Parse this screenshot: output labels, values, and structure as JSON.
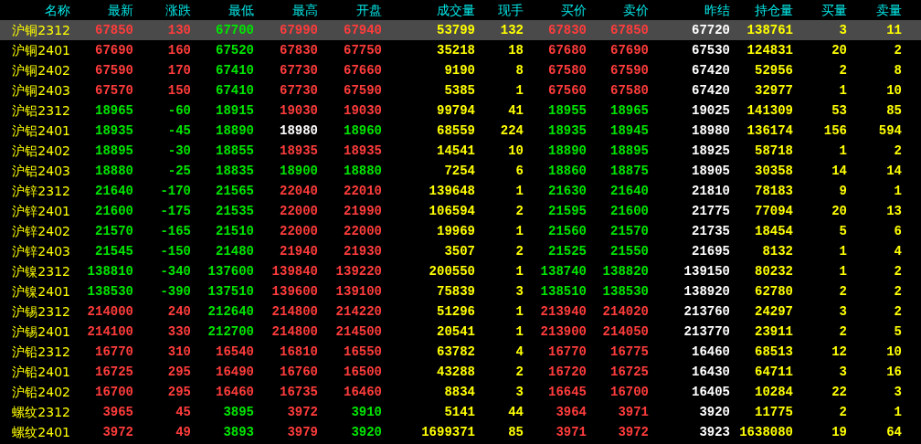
{
  "table": {
    "columns": [
      {
        "label": "名称",
        "kind": "name"
      },
      {
        "label": "最新",
        "kind": "price"
      },
      {
        "label": "涨跌",
        "kind": "price"
      },
      {
        "label": "最低",
        "kind": "price"
      },
      {
        "label": "最高",
        "kind": "price"
      },
      {
        "label": "开盘",
        "kind": "price"
      },
      {
        "label": "成交量",
        "kind": "volume"
      },
      {
        "label": "现手",
        "kind": "volume"
      },
      {
        "label": "买价",
        "kind": "price"
      },
      {
        "label": "卖价",
        "kind": "price"
      },
      {
        "label": "昨结",
        "kind": "settle"
      },
      {
        "label": "持仓量",
        "kind": "volume"
      },
      {
        "label": "买量",
        "kind": "volume"
      },
      {
        "label": "卖量",
        "kind": "volume"
      }
    ],
    "rows": [
      {
        "selected": true,
        "cells": [
          "沪铜2312",
          {
            "text": "67850",
            "color": "#ff3c3c"
          },
          {
            "text": "130",
            "color": "#ff3c3c"
          },
          {
            "text": "67700",
            "color": "#00e600"
          },
          {
            "text": "67990",
            "color": "#ff3c3c"
          },
          {
            "text": "67940",
            "color": "#ff3c3c"
          },
          "53799",
          "132",
          {
            "text": "67830",
            "color": "#ff3c3c"
          },
          {
            "text": "67850",
            "color": "#ff3c3c"
          },
          "67720",
          "138761",
          "3",
          "11"
        ]
      },
      {
        "selected": false,
        "cells": [
          "沪铜2401",
          {
            "text": "67690",
            "color": "#ff3c3c"
          },
          {
            "text": "160",
            "color": "#ff3c3c"
          },
          {
            "text": "67520",
            "color": "#00e600"
          },
          {
            "text": "67830",
            "color": "#ff3c3c"
          },
          {
            "text": "67750",
            "color": "#ff3c3c"
          },
          "35218",
          "18",
          {
            "text": "67680",
            "color": "#ff3c3c"
          },
          {
            "text": "67690",
            "color": "#ff3c3c"
          },
          "67530",
          "124831",
          "20",
          "2"
        ]
      },
      {
        "selected": false,
        "cells": [
          "沪铜2402",
          {
            "text": "67590",
            "color": "#ff3c3c"
          },
          {
            "text": "170",
            "color": "#ff3c3c"
          },
          {
            "text": "67410",
            "color": "#00e600"
          },
          {
            "text": "67730",
            "color": "#ff3c3c"
          },
          {
            "text": "67660",
            "color": "#ff3c3c"
          },
          "9190",
          "8",
          {
            "text": "67580",
            "color": "#ff3c3c"
          },
          {
            "text": "67590",
            "color": "#ff3c3c"
          },
          "67420",
          "52956",
          "2",
          "8"
        ]
      },
      {
        "selected": false,
        "cells": [
          "沪铜2403",
          {
            "text": "67570",
            "color": "#ff3c3c"
          },
          {
            "text": "150",
            "color": "#ff3c3c"
          },
          {
            "text": "67410",
            "color": "#00e600"
          },
          {
            "text": "67730",
            "color": "#ff3c3c"
          },
          {
            "text": "67590",
            "color": "#ff3c3c"
          },
          "5385",
          "1",
          {
            "text": "67560",
            "color": "#ff3c3c"
          },
          {
            "text": "67580",
            "color": "#ff3c3c"
          },
          "67420",
          "32977",
          "1",
          "10"
        ]
      },
      {
        "selected": false,
        "cells": [
          "沪铝2312",
          {
            "text": "18965",
            "color": "#00e600"
          },
          {
            "text": "-60",
            "color": "#00e600"
          },
          {
            "text": "18915",
            "color": "#00e600"
          },
          {
            "text": "19030",
            "color": "#ff3c3c"
          },
          {
            "text": "19030",
            "color": "#ff3c3c"
          },
          "99794",
          "41",
          {
            "text": "18955",
            "color": "#00e600"
          },
          {
            "text": "18965",
            "color": "#00e600"
          },
          "19025",
          "141309",
          "53",
          "85"
        ]
      },
      {
        "selected": false,
        "cells": [
          "沪铝2401",
          {
            "text": "18935",
            "color": "#00e600"
          },
          {
            "text": "-45",
            "color": "#00e600"
          },
          {
            "text": "18890",
            "color": "#00e600"
          },
          {
            "text": "18980",
            "color": "#ffffff"
          },
          {
            "text": "18960",
            "color": "#00e600"
          },
          "68559",
          "224",
          {
            "text": "18935",
            "color": "#00e600"
          },
          {
            "text": "18945",
            "color": "#00e600"
          },
          "18980",
          "136174",
          "156",
          "594"
        ]
      },
      {
        "selected": false,
        "cells": [
          "沪铝2402",
          {
            "text": "18895",
            "color": "#00e600"
          },
          {
            "text": "-30",
            "color": "#00e600"
          },
          {
            "text": "18855",
            "color": "#00e600"
          },
          {
            "text": "18935",
            "color": "#ff3c3c"
          },
          {
            "text": "18935",
            "color": "#ff3c3c"
          },
          "14541",
          "10",
          {
            "text": "18890",
            "color": "#00e600"
          },
          {
            "text": "18895",
            "color": "#00e600"
          },
          "18925",
          "58718",
          "1",
          "2"
        ]
      },
      {
        "selected": false,
        "cells": [
          "沪铝2403",
          {
            "text": "18880",
            "color": "#00e600"
          },
          {
            "text": "-25",
            "color": "#00e600"
          },
          {
            "text": "18835",
            "color": "#00e600"
          },
          {
            "text": "18900",
            "color": "#00e600"
          },
          {
            "text": "18880",
            "color": "#00e600"
          },
          "7254",
          "6",
          {
            "text": "18860",
            "color": "#00e600"
          },
          {
            "text": "18875",
            "color": "#00e600"
          },
          "18905",
          "30358",
          "14",
          "14"
        ]
      },
      {
        "selected": false,
        "cells": [
          "沪锌2312",
          {
            "text": "21640",
            "color": "#00e600"
          },
          {
            "text": "-170",
            "color": "#00e600"
          },
          {
            "text": "21565",
            "color": "#00e600"
          },
          {
            "text": "22040",
            "color": "#ff3c3c"
          },
          {
            "text": "22010",
            "color": "#ff3c3c"
          },
          "139648",
          "1",
          {
            "text": "21630",
            "color": "#00e600"
          },
          {
            "text": "21640",
            "color": "#00e600"
          },
          "21810",
          "78183",
          "9",
          "1"
        ]
      },
      {
        "selected": false,
        "cells": [
          "沪锌2401",
          {
            "text": "21600",
            "color": "#00e600"
          },
          {
            "text": "-175",
            "color": "#00e600"
          },
          {
            "text": "21535",
            "color": "#00e600"
          },
          {
            "text": "22000",
            "color": "#ff3c3c"
          },
          {
            "text": "21990",
            "color": "#ff3c3c"
          },
          "106594",
          "2",
          {
            "text": "21595",
            "color": "#00e600"
          },
          {
            "text": "21600",
            "color": "#00e600"
          },
          "21775",
          "77094",
          "20",
          "13"
        ]
      },
      {
        "selected": false,
        "cells": [
          "沪锌2402",
          {
            "text": "21570",
            "color": "#00e600"
          },
          {
            "text": "-165",
            "color": "#00e600"
          },
          {
            "text": "21510",
            "color": "#00e600"
          },
          {
            "text": "22000",
            "color": "#ff3c3c"
          },
          {
            "text": "22000",
            "color": "#ff3c3c"
          },
          "19969",
          "1",
          {
            "text": "21560",
            "color": "#00e600"
          },
          {
            "text": "21570",
            "color": "#00e600"
          },
          "21735",
          "18454",
          "5",
          "6"
        ]
      },
      {
        "selected": false,
        "cells": [
          "沪锌2403",
          {
            "text": "21545",
            "color": "#00e600"
          },
          {
            "text": "-150",
            "color": "#00e600"
          },
          {
            "text": "21480",
            "color": "#00e600"
          },
          {
            "text": "21940",
            "color": "#ff3c3c"
          },
          {
            "text": "21930",
            "color": "#ff3c3c"
          },
          "3507",
          "2",
          {
            "text": "21525",
            "color": "#00e600"
          },
          {
            "text": "21550",
            "color": "#00e600"
          },
          "21695",
          "8132",
          "1",
          "4"
        ]
      },
      {
        "selected": false,
        "cells": [
          "沪镍2312",
          {
            "text": "138810",
            "color": "#00e600"
          },
          {
            "text": "-340",
            "color": "#00e600"
          },
          {
            "text": "137600",
            "color": "#00e600"
          },
          {
            "text": "139840",
            "color": "#ff3c3c"
          },
          {
            "text": "139220",
            "color": "#ff3c3c"
          },
          "200550",
          "1",
          {
            "text": "138740",
            "color": "#00e600"
          },
          {
            "text": "138820",
            "color": "#00e600"
          },
          "139150",
          "80232",
          "1",
          "2"
        ]
      },
      {
        "selected": false,
        "cells": [
          "沪镍2401",
          {
            "text": "138530",
            "color": "#00e600"
          },
          {
            "text": "-390",
            "color": "#00e600"
          },
          {
            "text": "137510",
            "color": "#00e600"
          },
          {
            "text": "139600",
            "color": "#ff3c3c"
          },
          {
            "text": "139100",
            "color": "#ff3c3c"
          },
          "75839",
          "3",
          {
            "text": "138510",
            "color": "#00e600"
          },
          {
            "text": "138530",
            "color": "#00e600"
          },
          "138920",
          "62780",
          "2",
          "2"
        ]
      },
      {
        "selected": false,
        "cells": [
          "沪锡2312",
          {
            "text": "214000",
            "color": "#ff3c3c"
          },
          {
            "text": "240",
            "color": "#ff3c3c"
          },
          {
            "text": "212640",
            "color": "#00e600"
          },
          {
            "text": "214800",
            "color": "#ff3c3c"
          },
          {
            "text": "214220",
            "color": "#ff3c3c"
          },
          "51296",
          "1",
          {
            "text": "213940",
            "color": "#ff3c3c"
          },
          {
            "text": "214020",
            "color": "#ff3c3c"
          },
          "213760",
          "24297",
          "3",
          "2"
        ]
      },
      {
        "selected": false,
        "cells": [
          "沪锡2401",
          {
            "text": "214100",
            "color": "#ff3c3c"
          },
          {
            "text": "330",
            "color": "#ff3c3c"
          },
          {
            "text": "212700",
            "color": "#00e600"
          },
          {
            "text": "214800",
            "color": "#ff3c3c"
          },
          {
            "text": "214500",
            "color": "#ff3c3c"
          },
          "20541",
          "1",
          {
            "text": "213900",
            "color": "#ff3c3c"
          },
          {
            "text": "214050",
            "color": "#ff3c3c"
          },
          "213770",
          "23911",
          "2",
          "5"
        ]
      },
      {
        "selected": false,
        "cells": [
          "沪铅2312",
          {
            "text": "16770",
            "color": "#ff3c3c"
          },
          {
            "text": "310",
            "color": "#ff3c3c"
          },
          {
            "text": "16540",
            "color": "#ff3c3c"
          },
          {
            "text": "16810",
            "color": "#ff3c3c"
          },
          {
            "text": "16550",
            "color": "#ff3c3c"
          },
          "63782",
          "4",
          {
            "text": "16770",
            "color": "#ff3c3c"
          },
          {
            "text": "16775",
            "color": "#ff3c3c"
          },
          "16460",
          "68513",
          "12",
          "10"
        ]
      },
      {
        "selected": false,
        "cells": [
          "沪铅2401",
          {
            "text": "16725",
            "color": "#ff3c3c"
          },
          {
            "text": "295",
            "color": "#ff3c3c"
          },
          {
            "text": "16490",
            "color": "#ff3c3c"
          },
          {
            "text": "16760",
            "color": "#ff3c3c"
          },
          {
            "text": "16500",
            "color": "#ff3c3c"
          },
          "43288",
          "2",
          {
            "text": "16720",
            "color": "#ff3c3c"
          },
          {
            "text": "16725",
            "color": "#ff3c3c"
          },
          "16430",
          "64711",
          "3",
          "16"
        ]
      },
      {
        "selected": false,
        "cells": [
          "沪铅2402",
          {
            "text": "16700",
            "color": "#ff3c3c"
          },
          {
            "text": "295",
            "color": "#ff3c3c"
          },
          {
            "text": "16460",
            "color": "#ff3c3c"
          },
          {
            "text": "16735",
            "color": "#ff3c3c"
          },
          {
            "text": "16460",
            "color": "#ff3c3c"
          },
          "8834",
          "3",
          {
            "text": "16645",
            "color": "#ff3c3c"
          },
          {
            "text": "16700",
            "color": "#ff3c3c"
          },
          "16405",
          "10284",
          "22",
          "3"
        ]
      },
      {
        "selected": false,
        "cells": [
          "螺纹2312",
          {
            "text": "3965",
            "color": "#ff3c3c"
          },
          {
            "text": "45",
            "color": "#ff3c3c"
          },
          {
            "text": "3895",
            "color": "#00e600"
          },
          {
            "text": "3972",
            "color": "#ff3c3c"
          },
          {
            "text": "3910",
            "color": "#00e600"
          },
          "5141",
          "44",
          {
            "text": "3964",
            "color": "#ff3c3c"
          },
          {
            "text": "3971",
            "color": "#ff3c3c"
          },
          "3920",
          "11775",
          "2",
          "1"
        ]
      },
      {
        "selected": false,
        "cells": [
          "螺纹2401",
          {
            "text": "3972",
            "color": "#ff3c3c"
          },
          {
            "text": "49",
            "color": "#ff3c3c"
          },
          {
            "text": "3893",
            "color": "#00e600"
          },
          {
            "text": "3979",
            "color": "#ff3c3c"
          },
          {
            "text": "3920",
            "color": "#00e600"
          },
          "1699371",
          "85",
          {
            "text": "3971",
            "color": "#ff3c3c"
          },
          {
            "text": "3972",
            "color": "#ff3c3c"
          },
          "3923",
          "1638080",
          "19",
          "64"
        ]
      }
    ]
  }
}
